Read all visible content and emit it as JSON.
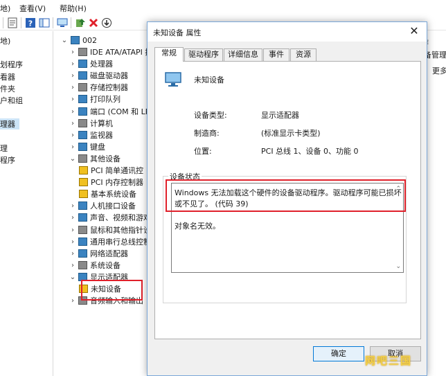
{
  "menubar": {
    "items": [
      "地)",
      "查看(V)",
      "帮助(H)"
    ]
  },
  "left_pane": {
    "items": [
      "地)",
      "划程序",
      "看器",
      "件夹",
      "户和组",
      "理器",
      "理",
      "程序"
    ],
    "selected_index": 5
  },
  "tree": {
    "root_label": "002",
    "items": [
      {
        "label": "IDE ATA/ATAPI 控",
        "expanded": false,
        "icon": "disk-controller-icon"
      },
      {
        "label": "处理器",
        "expanded": false,
        "icon": "processor-icon"
      },
      {
        "label": "磁盘驱动器",
        "expanded": false,
        "icon": "disk-drive-icon"
      },
      {
        "label": "存储控制器",
        "expanded": false,
        "icon": "storage-controller-icon"
      },
      {
        "label": "打印队列",
        "expanded": false,
        "icon": "printer-icon"
      },
      {
        "label": "端口 (COM 和 LP",
        "expanded": false,
        "icon": "port-icon"
      },
      {
        "label": "计算机",
        "expanded": false,
        "icon": "computer-icon"
      },
      {
        "label": "监视器",
        "expanded": false,
        "icon": "monitor-icon"
      },
      {
        "label": "键盘",
        "expanded": false,
        "icon": "keyboard-icon"
      },
      {
        "label": "其他设备",
        "expanded": true,
        "icon": "other-devices-icon"
      },
      {
        "label": "PCI 简单通讯控",
        "child": true,
        "icon": "warning-device-icon"
      },
      {
        "label": "PCI 内存控制器",
        "child": true,
        "icon": "warning-device-icon"
      },
      {
        "label": "基本系统设备",
        "child": true,
        "icon": "warning-device-icon"
      },
      {
        "label": "人机接口设备",
        "expanded": false,
        "icon": "hid-icon"
      },
      {
        "label": "声音、视频和游戏",
        "expanded": false,
        "icon": "sound-icon"
      },
      {
        "label": "鼠标和其他指针设",
        "expanded": false,
        "icon": "mouse-icon"
      },
      {
        "label": "通用串行总线控制",
        "expanded": false,
        "icon": "usb-icon"
      },
      {
        "label": "网络适配器",
        "expanded": false,
        "icon": "network-icon"
      },
      {
        "label": "系统设备",
        "expanded": false,
        "icon": "system-icon"
      },
      {
        "label": "显示适配器",
        "expanded": true,
        "icon": "display-icon"
      },
      {
        "label": "未知设备",
        "child": true,
        "icon": "warning-device-icon"
      },
      {
        "label": "音频输入和输出",
        "expanded": false,
        "icon": "audio-io-icon"
      }
    ]
  },
  "right_pane": {
    "header": "作",
    "items": [
      "备管理",
      "更多"
    ]
  },
  "dialog": {
    "title": "未知设备 属性",
    "close_glyph": "✕",
    "tabs": [
      "常规",
      "驱动程序",
      "详细信息",
      "事件",
      "资源"
    ],
    "active_tab": 0,
    "device_name": "未知设备",
    "properties": [
      {
        "label": "设备类型:",
        "value": "显示适配器"
      },
      {
        "label": "制造商:",
        "value": "(标准显示卡类型)"
      },
      {
        "label": "位置:",
        "value": "PCI 总线 1、设备 0、功能 0"
      }
    ],
    "status_group_label": "设备状态",
    "status_lines": [
      "Windows 无法加载这个硬件的设备驱动程序。驱动程序可能已损坏",
      "或不见了。 (代码 39)",
      "",
      "对象名无效。"
    ],
    "ok_label": "确定",
    "cancel_label": "取消"
  },
  "watermark": "网吧三国",
  "colors": {
    "highlight": "#e0202a",
    "selection": "#cce4f7",
    "accent": "#0078d7"
  }
}
